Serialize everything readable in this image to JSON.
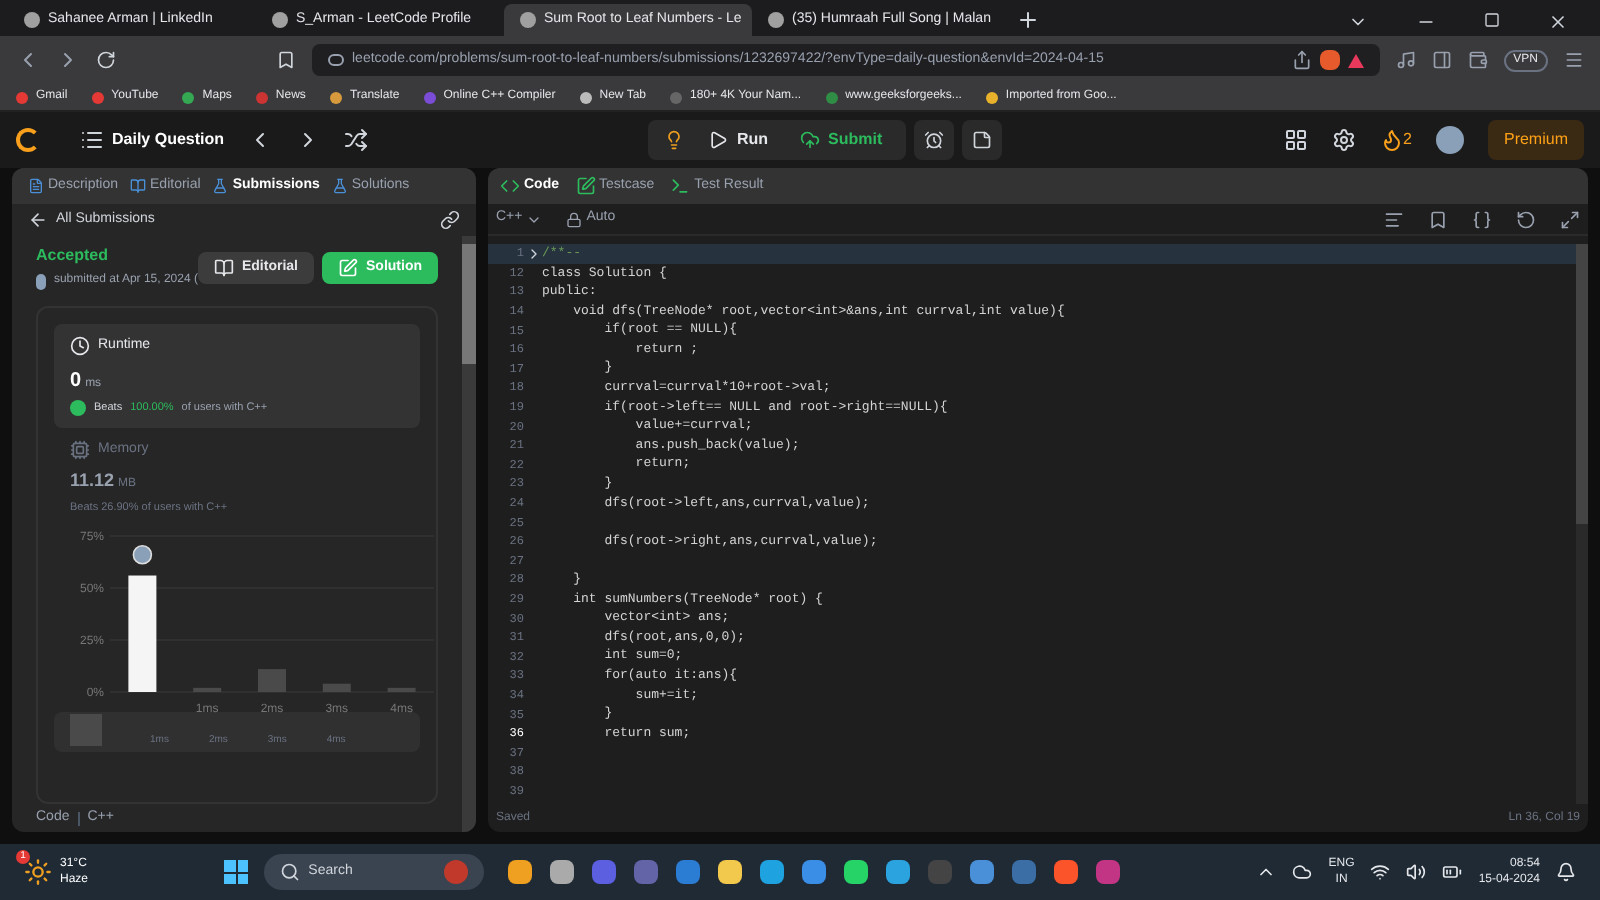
{
  "browser": {
    "tabs": [
      {
        "title": "Sahanee Arman | LinkedIn",
        "selected": false
      },
      {
        "title": "S_Arman - LeetCode Profile",
        "selected": false
      },
      {
        "title": "Sum Root to Leaf Numbers - Le",
        "selected": true
      },
      {
        "title": "(35) Humraah Full Song | Malan",
        "selected": false
      }
    ],
    "address": {
      "url": "leetcode.com/problems/sum-root-to-leaf-numbers/submissions/1232697422/?envType=daily-question&envId=2024-04-15"
    },
    "vpn": "VPN",
    "bookmarks": [
      "Gmail",
      "YouTube",
      "Maps",
      "News",
      "Translate",
      "Online C++ Compiler",
      "New Tab",
      "180+ 4K Your Nam...",
      "www.geeksforgeeks...",
      "Imported from Goo..."
    ]
  },
  "header": {
    "title": "Daily Question",
    "run": "Run",
    "submit": "Submit",
    "streak": "2",
    "premium": "Premium"
  },
  "left": {
    "tabs": [
      {
        "label": "Description",
        "selected": false
      },
      {
        "label": "Editorial",
        "selected": false
      },
      {
        "label": "Submissions",
        "selected": true
      },
      {
        "label": "Solutions",
        "selected": false
      }
    ],
    "back": "All Submissions",
    "status": "Accepted",
    "submitted": "submitted at Apr 15, 2024 (",
    "editorial": "Editorial",
    "solution": "Solution",
    "runtime": {
      "title": "Runtime",
      "value": "0",
      "unit": "ms",
      "beats": "Beats",
      "percent": "100.00%",
      "suffix": "of users with C++"
    },
    "memory": {
      "title": "Memory",
      "value": "11.12",
      "unit": "MB",
      "beats": "Beats 26.90% of users with C++"
    },
    "chart_data": {
      "type": "bar",
      "x": [
        0,
        1,
        2,
        3,
        4
      ],
      "xlim": [
        -0.5,
        4.5
      ],
      "ylim": [
        0,
        75
      ],
      "yticks": [
        {
          "value": 0,
          "label": "0%"
        },
        {
          "value": 25,
          "label": "25%"
        },
        {
          "value": 50,
          "label": "50%"
        },
        {
          "value": 75,
          "label": "75%"
        }
      ],
      "xticks": [
        {
          "value": 1,
          "label": "1ms"
        },
        {
          "value": 2,
          "label": "2ms"
        },
        {
          "value": 3,
          "label": "3ms"
        },
        {
          "value": 4,
          "label": "4ms"
        }
      ],
      "series": [
        {
          "color": "#f5f5f5",
          "values": [
            56,
            null,
            null,
            null,
            null
          ]
        },
        {
          "color": "#4a4a4a",
          "values": [
            null,
            2,
            11,
            4,
            2
          ]
        }
      ]
    },
    "overview": [
      "1ms",
      "2ms",
      "3ms",
      "4ms"
    ],
    "footer": [
      "Code",
      "C++"
    ]
  },
  "editor": {
    "tabs": [
      {
        "label": "Code",
        "selected": true
      },
      {
        "label": "Testcase",
        "selected": false
      },
      {
        "label": "Test Result",
        "selected": false
      }
    ],
    "language": "C++",
    "mode": "Auto",
    "lines": [
      {
        "num": "1",
        "text": "/**-- ",
        "kind": "fold",
        "current": false
      },
      {
        "num": "12",
        "text": "class Solution {",
        "kind": "code",
        "current": false
      },
      {
        "num": "13",
        "text": "public:",
        "kind": "code",
        "current": false
      },
      {
        "num": "14",
        "text": "    void dfs(TreeNode* root,vector<int>&ans,int currval,int value){",
        "kind": "code",
        "current": false
      },
      {
        "num": "15",
        "text": "        if(root == NULL){",
        "kind": "code",
        "current": false
      },
      {
        "num": "16",
        "text": "            return ;",
        "kind": "code",
        "current": false
      },
      {
        "num": "17",
        "text": "        }",
        "kind": "code",
        "current": false
      },
      {
        "num": "18",
        "text": "        currval=currval*10+root->val;",
        "kind": "code",
        "current": false
      },
      {
        "num": "19",
        "text": "        if(root->left== NULL and root->right==NULL){",
        "kind": "code",
        "current": false
      },
      {
        "num": "20",
        "text": "            value+=currval;",
        "kind": "code",
        "current": false
      },
      {
        "num": "21",
        "text": "            ans.push_back(value);",
        "kind": "code",
        "current": false
      },
      {
        "num": "22",
        "text": "            return;",
        "kind": "code",
        "current": false
      },
      {
        "num": "23",
        "text": "        }",
        "kind": "code",
        "current": false
      },
      {
        "num": "24",
        "text": "        dfs(root->left,ans,currval,value);",
        "kind": "code",
        "current": false
      },
      {
        "num": "25",
        "kind": "code",
        "current": false
      },
      {
        "num": "26",
        "text": "        dfs(root->right,ans,currval,value);",
        "kind": "code",
        "current": false
      },
      {
        "num": "27",
        "kind": "code",
        "current": false
      },
      {
        "num": "28",
        "text": "    }",
        "kind": "code",
        "current": false
      },
      {
        "num": "29",
        "text": "    int sumNumbers(TreeNode* root) {",
        "kind": "code",
        "current": false
      },
      {
        "num": "30",
        "text": "        vector<int> ans;",
        "kind": "code",
        "current": false
      },
      {
        "num": "31",
        "text": "        dfs(root,ans,0,0);",
        "kind": "code",
        "current": false
      },
      {
        "num": "32",
        "text": "        int sum=0;",
        "kind": "code",
        "current": false
      },
      {
        "num": "33",
        "text": "        for(auto it:ans){",
        "kind": "code",
        "current": false
      },
      {
        "num": "34",
        "text": "            sum+=it;",
        "kind": "code",
        "current": false
      },
      {
        "num": "35",
        "text": "        }",
        "kind": "code",
        "current": false
      },
      {
        "num": "36",
        "text": "        return sum;",
        "kind": "code",
        "current": true
      },
      {
        "num": "37",
        "kind": "code",
        "current": false
      },
      {
        "num": "38",
        "kind": "code",
        "current": false
      },
      {
        "num": "39",
        "kind": "code",
        "current": false
      }
    ],
    "status": "Saved",
    "position": "Ln 36, Col 19"
  },
  "taskbar": {
    "temp": "31°C",
    "weather": "Haze",
    "badge": "1",
    "search": "Search",
    "lang": "ENG",
    "region": "IN",
    "time": "08:54",
    "date": "15-04-2024"
  }
}
